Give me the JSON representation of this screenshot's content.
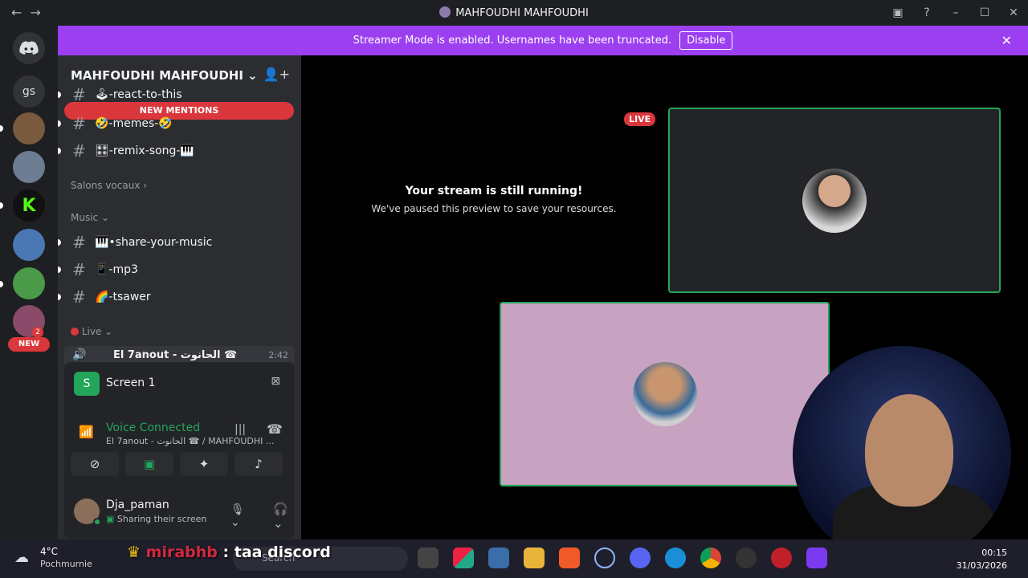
{
  "window": {
    "title": "MAHFOUDHI MAHFOUDHI",
    "back_icon": "arrow-left-icon",
    "forward_icon": "arrow-right-icon"
  },
  "banner": {
    "text": "Streamer Mode is enabled. Usernames have been truncated.",
    "button": "Disable"
  },
  "guilds": {
    "gs_label": "gs",
    "k_label": "K",
    "new_label": "NEW",
    "badge_count": "2"
  },
  "sidebar": {
    "server_name": "MAHFOUDHI MAHFOUDHI",
    "new_mentions": "NEW MENTIONS",
    "channels": [
      {
        "name": "🕹-react-to-this"
      },
      {
        "name": "🤣-memes-🤣"
      },
      {
        "name": "🎛-remix-song-🎹"
      }
    ],
    "category_voice": "Salons vocaux",
    "category_music": "Music",
    "music_channels": [
      {
        "name": "🎹•share-your-music"
      },
      {
        "name": "📱-mp3"
      },
      {
        "name": "🌈-tsawer"
      }
    ],
    "category_live": "Live",
    "live_channel": "El 7anout - الحانوت ☎",
    "live_time": "2:42"
  },
  "panel": {
    "screen_label": "Screen 1",
    "voice_title": "Voice Connected",
    "voice_sub": "El 7anout - الحانوت ☎ / MAHFOUDHI ...",
    "username": "Dja_paman",
    "user_status": "Sharing their screen"
  },
  "stream": {
    "live_badge": "LIVE",
    "paused_title": "Your stream is still running!",
    "paused_sub": "We've paused this preview to save your resources."
  },
  "taskbar": {
    "temp": "4°C",
    "weather": "Pochmurnie",
    "chat_nick": "mirabhb",
    "chat_msg": ": taa discord",
    "search": "Search",
    "time": "00:15",
    "date": "31/03/2026"
  }
}
